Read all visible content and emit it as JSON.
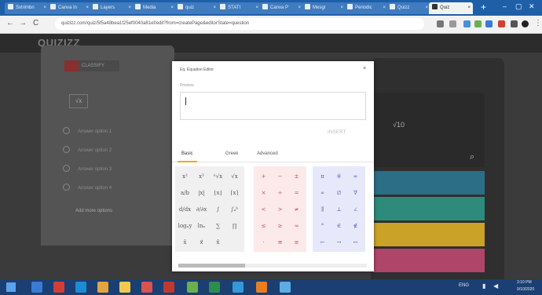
{
  "browser": {
    "tabs": [
      {
        "label": "Sxtrimbn",
        "active": false
      },
      {
        "label": "Canva In",
        "active": false
      },
      {
        "label": "Layers",
        "active": false
      },
      {
        "label": "Media",
        "active": false
      },
      {
        "label": "quiz",
        "active": false
      },
      {
        "label": "STATI",
        "active": false
      },
      {
        "label": "Canva P",
        "active": false
      },
      {
        "label": "Mesgr",
        "active": false
      },
      {
        "label": "Periodic",
        "active": false
      },
      {
        "label": "Quizz",
        "active": false
      },
      {
        "label": "Quiz",
        "active": true
      }
    ],
    "new_tab": "+",
    "window_controls": {
      "minimize": "–",
      "maximize": "▢",
      "close": "✕"
    },
    "back": "←",
    "forward": "→",
    "reload": "C",
    "url": "quizizz.com/quiz/5f5a48bea1f25ef0040a81ef/edit?from=createPage&editorState=question"
  },
  "app": {
    "logo": "QUIZIZZ",
    "question_type": "CLASSIFY",
    "sqrt_box": "√x",
    "options": [
      "Answer option 1",
      "Answer option 2",
      "Answer option 3",
      "Answer option 4"
    ],
    "add_option": "Add more options",
    "sqrt10": "√10",
    "zoom_icon": "⌕",
    "answer_colors": [
      "#2c6e86",
      "#2e8a7a",
      "#c9a227",
      "#b0456a"
    ]
  },
  "editor": {
    "title": "Eq. Equation Editor",
    "close": "×",
    "preview_label": "Preview",
    "insert": "INSERT",
    "tabs": [
      "Basic",
      "Greek",
      "Advanced"
    ],
    "active_tab": "Basic",
    "keys_group1": [
      "x²",
      "x³",
      "ⁿ√x",
      "√x",
      "a/b",
      "|x|",
      "⌊x⌋",
      "⌈x⌉",
      "d/dx",
      "∂/∂x",
      "∫",
      "∫ₐᵇ",
      "logₓy",
      "lnₓ",
      "∑",
      "∏",
      "x̄",
      "x⃗",
      "x̂",
      ""
    ],
    "keys_group2": [
      "+",
      "−",
      "±",
      "×",
      "÷",
      "=",
      "<",
      ">",
      "≠",
      "≤",
      "≥",
      "≈",
      "·",
      "≅",
      "≡"
    ],
    "keys_group3": [
      "π",
      "θ",
      "∞",
      "∝",
      "∅",
      "∇",
      "∥",
      "⊥",
      "∠",
      "°",
      "∈",
      "∉",
      "←",
      "→",
      "↔"
    ]
  },
  "taskbar": {
    "time": "3:10 PM",
    "date": "9/10/2020",
    "lang": "ENG",
    "icon_colors": [
      "#3a7bd5",
      "#d23f31",
      "#1e8cd3",
      "#e8a33d",
      "#f2c94c",
      "#d9534f",
      "#c0392b",
      "#6ab04c",
      "#2c8e4a",
      "#3498db",
      "#e67e22",
      "#5dade2"
    ]
  }
}
